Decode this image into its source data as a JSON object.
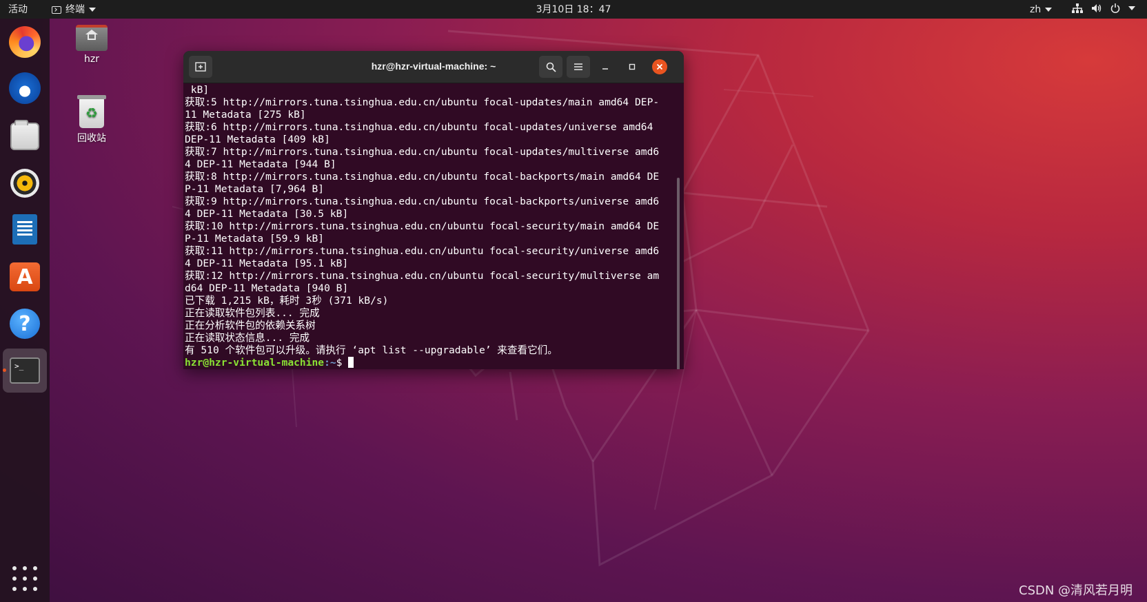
{
  "topbar": {
    "activities": "活动",
    "app_menu": "终端",
    "clock": "3月10日 18：47",
    "language": "zh"
  },
  "dock": {
    "apps": [
      "firefox",
      "thunderbird",
      "files",
      "rhythmbox",
      "libreoffice-writer",
      "ubuntu-software",
      "help",
      "terminal"
    ],
    "active_app": "terminal"
  },
  "desktop": {
    "home_label": "hzr",
    "trash_label": "回收站"
  },
  "terminal": {
    "title": "hzr@hzr-virtual-machine: ~",
    "lines": [
      " kB]",
      "获取:5 http://mirrors.tuna.tsinghua.edu.cn/ubuntu focal-updates/main amd64 DEP-",
      "11 Metadata [275 kB]",
      "获取:6 http://mirrors.tuna.tsinghua.edu.cn/ubuntu focal-updates/universe amd64",
      "DEP-11 Metadata [409 kB]",
      "获取:7 http://mirrors.tuna.tsinghua.edu.cn/ubuntu focal-updates/multiverse amd6",
      "4 DEP-11 Metadata [944 B]",
      "获取:8 http://mirrors.tuna.tsinghua.edu.cn/ubuntu focal-backports/main amd64 DE",
      "P-11 Metadata [7,964 B]",
      "获取:9 http://mirrors.tuna.tsinghua.edu.cn/ubuntu focal-backports/universe amd6",
      "4 DEP-11 Metadata [30.5 kB]",
      "获取:10 http://mirrors.tuna.tsinghua.edu.cn/ubuntu focal-security/main amd64 DE",
      "P-11 Metadata [59.9 kB]",
      "获取:11 http://mirrors.tuna.tsinghua.edu.cn/ubuntu focal-security/universe amd6",
      "4 DEP-11 Metadata [95.1 kB]",
      "获取:12 http://mirrors.tuna.tsinghua.edu.cn/ubuntu focal-security/multiverse am",
      "d64 DEP-11 Metadata [940 B]",
      "已下载 1,215 kB，耗时 3秒 (371 kB/s)",
      "正在读取软件包列表... 完成",
      "正在分析软件包的依赖关系树",
      "正在读取状态信息... 完成",
      "有 510 个软件包可以升级。请执行 ‘apt list --upgradable’ 来查看它们。"
    ],
    "prompt_user": "hzr@hzr-virtual-machine",
    "prompt_path": ":~",
    "prompt_symbol": "$ "
  },
  "watermark": "CSDN @清风若月明",
  "colors": {
    "terminal_bg": "#300a24",
    "prompt_user": "#8ae234",
    "prompt_path": "#729fcf",
    "accent": "#e95420"
  }
}
